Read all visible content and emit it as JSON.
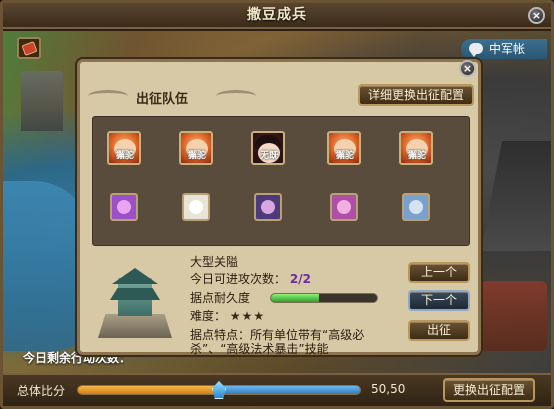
{
  "window": {
    "title": "撒豆成兵"
  },
  "camp_button": {
    "label": "中军帐"
  },
  "attempts_text": "今日剩余行动次数：",
  "dialog": {
    "section_title": "出征队伍",
    "detail_button": "详细更换出征配置",
    "heroes": [
      {
        "tag": "獬驼",
        "style": "red"
      },
      {
        "tag": "獬驼",
        "style": "red"
      },
      {
        "tag": "无既",
        "style": "girl"
      },
      {
        "tag": "獬驼",
        "style": "red"
      },
      {
        "tag": "獬驼",
        "style": "red"
      }
    ],
    "pets": [
      {
        "color": "#9b4fc9",
        "face": "#e9a6f0"
      },
      {
        "color": "#e9e4d8",
        "face": "#ffffff"
      },
      {
        "color": "#4c3a7a",
        "face": "#d9a6e0"
      },
      {
        "color": "#b04fa6",
        "face": "#f2b0e0"
      },
      {
        "color": "#7aa0d0",
        "face": "#d4e2f4"
      }
    ],
    "target": {
      "name": "大型关隘",
      "count_label": "今日可进攻次数：",
      "count_value": "2/2",
      "durability_label": "据点耐久度",
      "durability_fraction": 0.45,
      "difficulty_label": "难度：",
      "difficulty_stars": "★★★",
      "feature_label": "据点特点：",
      "feature_text": "所有单位带有“高级必杀”、“高级法术暴击”技能"
    },
    "buttons": {
      "prev": "上一个",
      "next": "下一个",
      "go": "出征"
    }
  },
  "bottom": {
    "ratio_label": "总体比分",
    "ratio_value": "50,50",
    "ratio_left_fraction": 0.5,
    "change_button": "更换出征配置"
  },
  "colors": {
    "accent": "#b8975a",
    "count_color": "#6a2fa0",
    "slider_left": "#f7b84a",
    "slider_right": "#6fb7ee",
    "hp_green": "#2f9f28"
  }
}
